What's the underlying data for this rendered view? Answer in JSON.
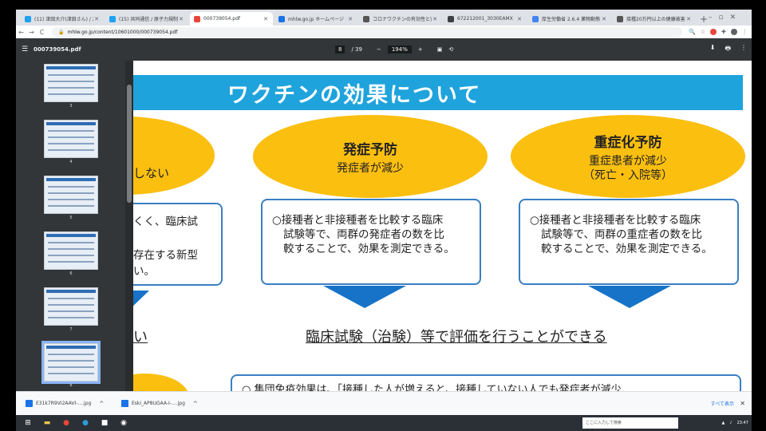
{
  "browser": {
    "tabs": [
      {
        "title": "(11) 津田大介(津田さん) / X",
        "icon": "twitter-icon",
        "color": "#1da1f2"
      },
      {
        "title": "(15) 共同通信 / 原子力規制",
        "icon": "twitter-icon",
        "color": "#1da1f2"
      },
      {
        "title": "000739054.pdf",
        "icon": "pdf-icon",
        "color": "#e8453c"
      },
      {
        "title": "mhlw.go.jp ホームページ",
        "icon": "globe-icon",
        "color": "#1a73e8"
      },
      {
        "title": "コロナワクチンの有効性と安全性",
        "icon": "doc-icon",
        "color": "#555555"
      },
      {
        "title": "672212001_3030EAMX",
        "icon": "pin-icon",
        "color": "#3c4043"
      },
      {
        "title": "厚生労働省 2.6.4 薬物動態",
        "icon": "google-icon",
        "color": "#4285f4"
      },
      {
        "title": "接種20万円以上の健康被害",
        "icon": "doc-icon",
        "color": "#555555"
      }
    ],
    "active_tab_index": 2,
    "new_tab_symbol": "+",
    "url": "mhlw.go.jp/content/10601000/000739054.pdf",
    "nav": {
      "back": "←",
      "forward": "→",
      "reload": "C"
    }
  },
  "pdf": {
    "filename": "000739054.pdf",
    "page_current": "8",
    "page_total": "/ 39",
    "zoom": "194%",
    "zoom_out": "−",
    "zoom_in": "+",
    "thumbnails": [
      "3",
      "4",
      "5",
      "6",
      "7",
      "8"
    ],
    "selected_thumbnail": "8"
  },
  "slide": {
    "title": "ワクチンの効果について",
    "left_fragments": {
      "ellipse_text": "しない",
      "box_line1": "くく、臨床試",
      "box_line2": "存在する新型",
      "box_line3": "い。",
      "underline_text": "い"
    },
    "col1": {
      "heading": "発症予防",
      "sub": "発症者が減少",
      "body1": "○接種者と非接種者を比較する臨床",
      "body2": "試験等で、両群の発症者の数を比",
      "body3": "較することで、効果を測定できる。"
    },
    "col2": {
      "heading": "重症化予防",
      "sub1": "重症患者が減少",
      "sub2": "（死亡・入院等）",
      "body1": "○接種者と非接種者を比較する臨床",
      "body2": "試験等で、両群の重症者の数を比",
      "body3": "較することで、効果を測定できる。"
    },
    "evaluation": "臨床試験（治験）等で評価を行うことができる",
    "bottom_text": "○ 集団免疫効果は、「接種した人が増えると、接種していない人でも発症者が減少"
  },
  "downloads": {
    "items": [
      "E31k7R9VI2AAVI-....jpg",
      "Eski_AP8UGAA-I-....jpg"
    ],
    "show_all": "すべて表示"
  },
  "taskbar": {
    "search_placeholder": "ここに入力して検索",
    "time": "23:47"
  }
}
